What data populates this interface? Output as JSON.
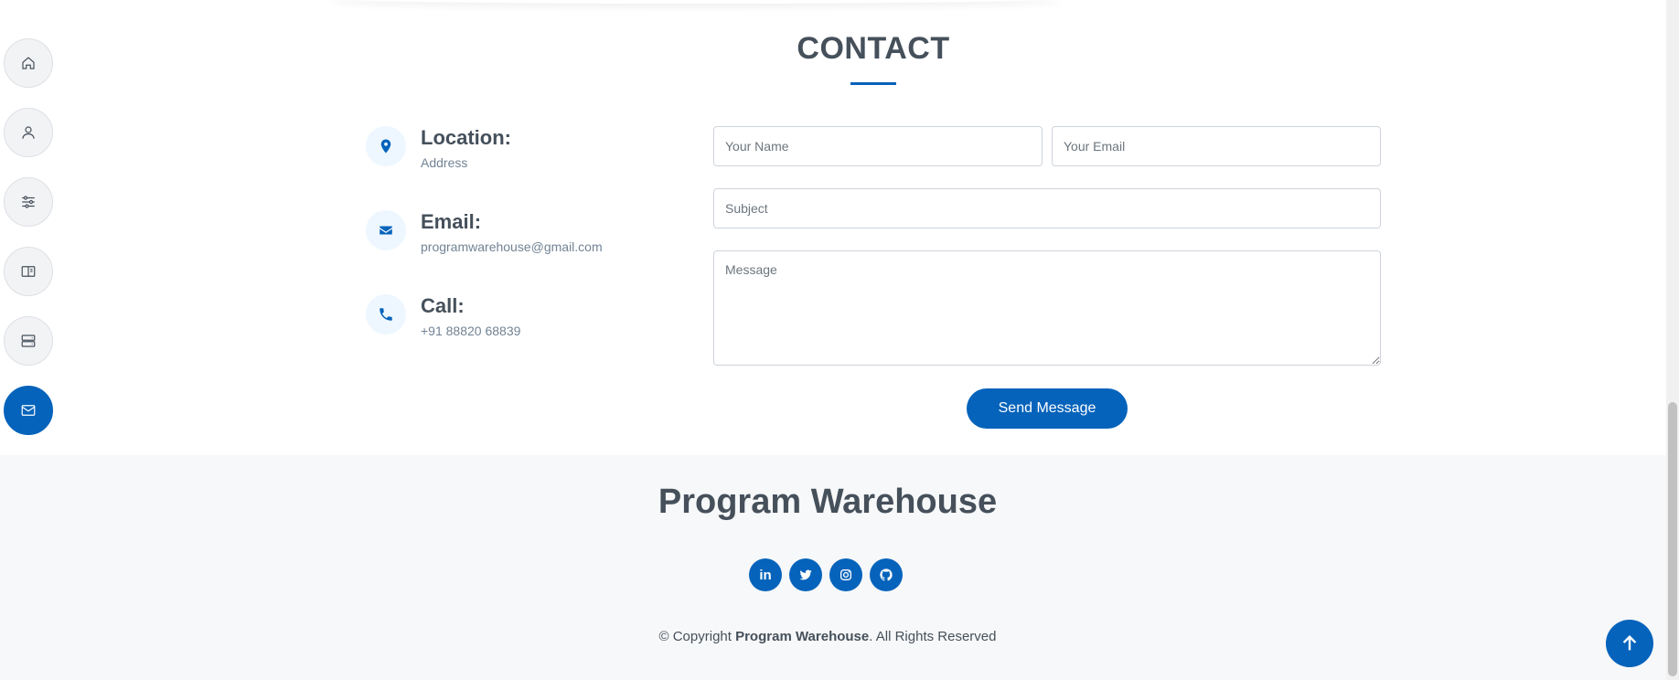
{
  "nav": {
    "items": [
      {
        "icon": "home-icon",
        "active": false
      },
      {
        "icon": "person-icon",
        "active": false
      },
      {
        "icon": "sliders-icon",
        "active": false
      },
      {
        "icon": "book-icon",
        "active": false
      },
      {
        "icon": "server-icon",
        "active": false
      },
      {
        "icon": "envelope-icon",
        "active": true
      }
    ]
  },
  "contact": {
    "title": "CONTACT",
    "location_label": "Location:",
    "location_value": "Address",
    "email_label": "Email:",
    "email_value": "programwarehouse@gmail.com",
    "call_label": "Call:",
    "call_value": "+91 88820 68839"
  },
  "form": {
    "name_placeholder": "Your Name",
    "email_placeholder": "Your Email",
    "subject_placeholder": "Subject",
    "message_placeholder": "Message",
    "send_label": "Send Message"
  },
  "footer": {
    "brand": "Program Warehouse",
    "socials": [
      "linkedin-icon",
      "twitter-icon",
      "instagram-icon",
      "github-icon"
    ],
    "copyright_prefix": "© Copyright ",
    "copyright_brand": "Program Warehouse",
    "copyright_suffix": ". All Rights Reserved"
  },
  "colors": {
    "accent": "#0563bb",
    "heading": "#45505b",
    "footer_bg": "#f7f8f9"
  }
}
